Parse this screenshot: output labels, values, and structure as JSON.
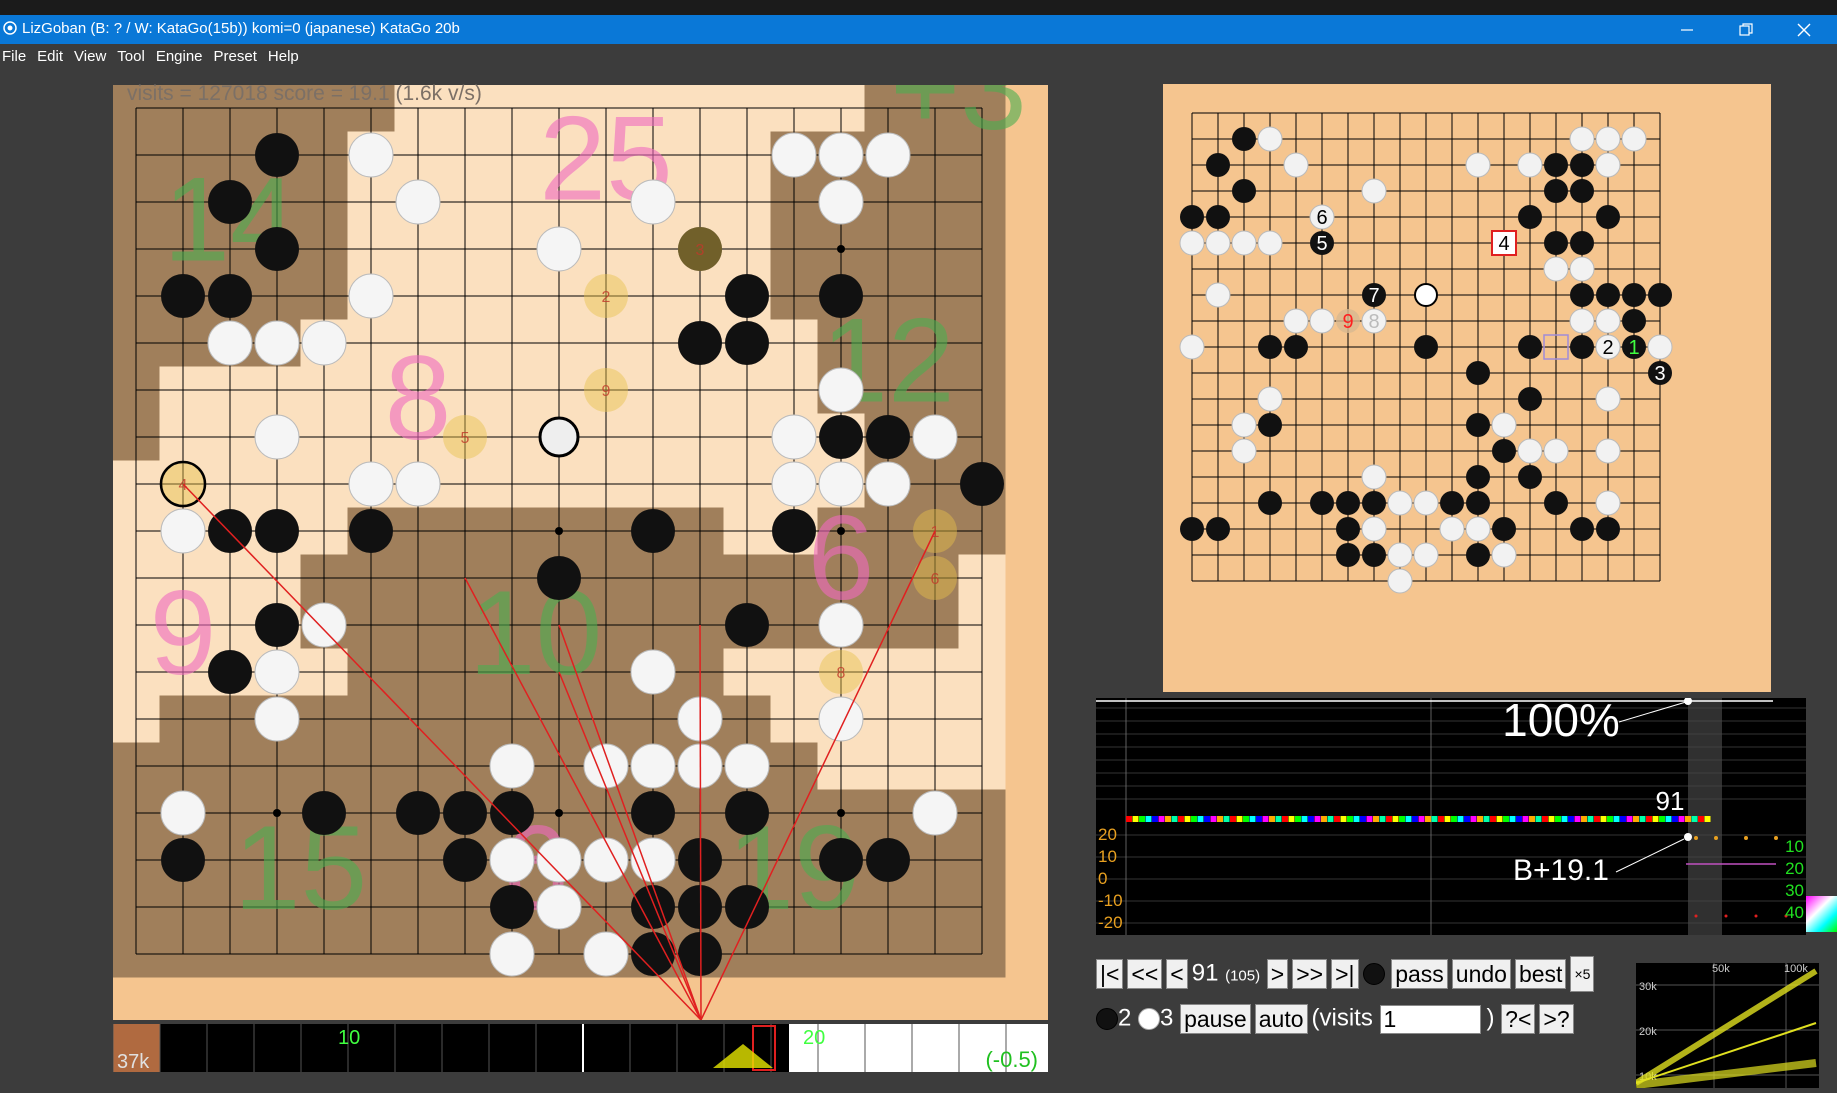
{
  "window": {
    "title": "LizGoban (B: ? / W: KataGo(15b))  komi=0 (japanese) KataGo 20b",
    "controls": [
      "minimize-icon",
      "restore-icon",
      "close-icon"
    ]
  },
  "menu": [
    "File",
    "Edit",
    "View",
    "Tool",
    "Engine",
    "Preset",
    "Help"
  ],
  "status": "visits = 127018  score = 19.1  (1.6k v/s)",
  "board": {
    "size": 19,
    "colors": {
      "wood": "#f5c58f",
      "dark": "#5a4632",
      "line": "#000000"
    },
    "area_rows": [
      "bbbbbbwwwwwwwwwwbbb",
      "bbbbbwwwwwwwwwbbbbb",
      "bbbbbwwwwwwwwwbbbbb",
      "bbbbbwwwwwwwwwbbbbb",
      "bbbbbwwwwwwwwwbbbbb",
      "bbbbwwwwwwwwwwwbbbb",
      "bwwwwwwwwwwwwwwbbbb",
      "bwwwwwwwwwwwwwwwbbb",
      "wwwwwwwwwwwwwwwwbbb",
      "wwwwwbbbbbbbbwwbbbb",
      "wwwwbbbbbbbbbbbbbbw",
      "wwwwbbbbbbbbbbbbbbw",
      "wwwwwbbbbbbbbwwwwww",
      "wbbbbbbbbbbbbbwwwww",
      "bbbbbbbbbbbbbbbwwww",
      "bbbbbbbbbbbbbbbbbbb",
      "bbbbbbbbbbbbbbbbbbb",
      "bbbbbbbbbbbbbbbbbbb",
      "bbbbbbbbbbbbbbbbbbb"
    ],
    "stones_black": [
      [
        3,
        1
      ],
      [
        2,
        2
      ],
      [
        3,
        3
      ],
      [
        1,
        4
      ],
      [
        2,
        4
      ],
      [
        2,
        5
      ],
      [
        13,
        4
      ],
      [
        12,
        3
      ],
      [
        12,
        5
      ],
      [
        13,
        5
      ],
      [
        15,
        4
      ],
      [
        14,
        7
      ],
      [
        15,
        7
      ],
      [
        16,
        7
      ],
      [
        18,
        8
      ],
      [
        2,
        9
      ],
      [
        3,
        9
      ],
      [
        5,
        9
      ],
      [
        11,
        9
      ],
      [
        14,
        9
      ],
      [
        9,
        10
      ],
      [
        3,
        11
      ],
      [
        13,
        11
      ],
      [
        2,
        12
      ],
      [
        3,
        12
      ],
      [
        11,
        12
      ],
      [
        12,
        13
      ],
      [
        11,
        14
      ],
      [
        13,
        14
      ],
      [
        11,
        15
      ],
      [
        1,
        16
      ],
      [
        4,
        15
      ],
      [
        6,
        15
      ],
      [
        7,
        15
      ],
      [
        8,
        15
      ],
      [
        11,
        16
      ],
      [
        12,
        16
      ],
      [
        15,
        16
      ],
      [
        16,
        16
      ],
      [
        7,
        16
      ],
      [
        8,
        17
      ],
      [
        11,
        17
      ],
      [
        12,
        17
      ],
      [
        13,
        17
      ],
      [
        11,
        18
      ],
      [
        12,
        18
      ],
      [
        13,
        15
      ]
    ],
    "stones_white": [
      [
        5,
        1
      ],
      [
        6,
        2
      ],
      [
        5,
        4
      ],
      [
        4,
        5
      ],
      [
        3,
        5
      ],
      [
        2,
        5
      ],
      [
        9,
        3
      ],
      [
        14,
        1
      ],
      [
        15,
        1
      ],
      [
        16,
        1
      ],
      [
        15,
        2
      ],
      [
        11,
        2
      ],
      [
        14,
        7
      ],
      [
        15,
        6
      ],
      [
        17,
        7
      ],
      [
        16,
        8
      ],
      [
        15,
        8
      ],
      [
        14,
        8
      ],
      [
        5,
        8
      ],
      [
        6,
        8
      ],
      [
        3,
        7
      ],
      [
        1,
        9
      ],
      [
        4,
        11
      ],
      [
        3,
        12
      ],
      [
        3,
        13
      ],
      [
        1,
        15
      ],
      [
        8,
        14
      ],
      [
        10,
        14
      ],
      [
        11,
        14
      ],
      [
        12,
        14
      ],
      [
        11,
        12
      ],
      [
        12,
        13
      ],
      [
        13,
        14
      ],
      [
        15,
        11
      ],
      [
        15,
        13
      ],
      [
        17,
        15
      ],
      [
        8,
        16
      ],
      [
        9,
        16
      ],
      [
        9,
        17
      ],
      [
        10,
        16
      ],
      [
        11,
        16
      ],
      [
        8,
        18
      ],
      [
        10,
        18
      ]
    ],
    "numbers": [
      {
        "text": "14",
        "col": 2,
        "row": 2.5,
        "color": "#4caf50"
      },
      {
        "text": "25",
        "col": 10,
        "row": 1.2,
        "color": "#f06bc0"
      },
      {
        "text": "+3",
        "col": 17.5,
        "row": -0.3,
        "color": "#4caf50"
      },
      {
        "text": "12",
        "col": 16,
        "row": 5.5,
        "color": "#4caf50"
      },
      {
        "text": "8",
        "col": 6,
        "row": 6.3,
        "color": "#f06bc0"
      },
      {
        "text": "9",
        "col": 1,
        "row": 11.3,
        "color": "#f06bc0"
      },
      {
        "text": "10",
        "col": 8.5,
        "row": 11.3,
        "color": "#4caf50"
      },
      {
        "text": "6",
        "col": 15,
        "row": 9.7,
        "color": "#f06bc0"
      },
      {
        "text": "15",
        "col": 3.5,
        "row": 16.3,
        "color": "#4caf50"
      },
      {
        "text": "6",
        "col": 8.5,
        "row": 16.3,
        "color": "#f06bc0"
      },
      {
        "text": "19",
        "col": 14,
        "row": 16.3,
        "color": "#4caf50"
      }
    ],
    "candidates": [
      {
        "text": "1",
        "col": 17,
        "row": 9
      },
      {
        "text": "2",
        "col": 10,
        "row": 4
      },
      {
        "text": "3",
        "col": 12,
        "row": 3
      },
      {
        "text": "4",
        "col": 1,
        "row": 8
      },
      {
        "text": "5",
        "col": 7,
        "row": 7
      },
      {
        "text": "6",
        "col": 17,
        "row": 10
      },
      {
        "text": "8",
        "col": 15,
        "row": 12
      },
      {
        "text": "9",
        "col": 10,
        "row": 6
      }
    ]
  },
  "subboard": {
    "black": [
      [
        2,
        1
      ],
      [
        1,
        2
      ],
      [
        2,
        3
      ],
      [
        0,
        4
      ],
      [
        1,
        4
      ],
      [
        1,
        5
      ],
      [
        5,
        4
      ],
      [
        10,
        15
      ],
      [
        15,
        2
      ],
      [
        14,
        2
      ],
      [
        15,
        3
      ],
      [
        14,
        3
      ],
      [
        16,
        4
      ],
      [
        13,
        4
      ],
      [
        14,
        5
      ],
      [
        15,
        5
      ],
      [
        16,
        7
      ],
      [
        15,
        7
      ],
      [
        17,
        7
      ],
      [
        17,
        8
      ],
      [
        3,
        9
      ],
      [
        4,
        9
      ],
      [
        9,
        9
      ],
      [
        13,
        9
      ],
      [
        15,
        9
      ],
      [
        11,
        10
      ],
      [
        13,
        11
      ],
      [
        3,
        11
      ],
      [
        2,
        12
      ],
      [
        3,
        12
      ],
      [
        11,
        12
      ],
      [
        12,
        13
      ],
      [
        11,
        14
      ],
      [
        13,
        14
      ],
      [
        11,
        15
      ],
      [
        0,
        16
      ],
      [
        1,
        16
      ],
      [
        3,
        15
      ],
      [
        5,
        15
      ],
      [
        6,
        15
      ],
      [
        7,
        15
      ],
      [
        6,
        16
      ],
      [
        7,
        17
      ],
      [
        6,
        17
      ],
      [
        11,
        16
      ],
      [
        12,
        16
      ],
      [
        11,
        17
      ],
      [
        12,
        17
      ],
      [
        14,
        15
      ],
      [
        15,
        16
      ],
      [
        16,
        16
      ],
      [
        18,
        7
      ]
    ],
    "white": [
      [
        3,
        1
      ],
      [
        4,
        2
      ],
      [
        1,
        5
      ],
      [
        0,
        5
      ],
      [
        2,
        5
      ],
      [
        3,
        5
      ],
      [
        11,
        2
      ],
      [
        15,
        1
      ],
      [
        16,
        1
      ],
      [
        17,
        1
      ],
      [
        16,
        2
      ],
      [
        13,
        2
      ],
      [
        7,
        3
      ],
      [
        14,
        6
      ],
      [
        15,
        6
      ],
      [
        16,
        8
      ],
      [
        15,
        8
      ],
      [
        16,
        9
      ],
      [
        18,
        9
      ],
      [
        1,
        7
      ],
      [
        4,
        8
      ],
      [
        5,
        8
      ],
      [
        0,
        9
      ],
      [
        3,
        11
      ],
      [
        2,
        12
      ],
      [
        2,
        13
      ],
      [
        12,
        12
      ],
      [
        13,
        13
      ],
      [
        14,
        13
      ],
      [
        16,
        11
      ],
      [
        16,
        13
      ],
      [
        16,
        15
      ],
      [
        7,
        14
      ],
      [
        8,
        15
      ],
      [
        9,
        15
      ],
      [
        7,
        16
      ],
      [
        10,
        16
      ],
      [
        8,
        17
      ],
      [
        9,
        17
      ],
      [
        11,
        16
      ],
      [
        12,
        17
      ],
      [
        8,
        18
      ]
    ],
    "seq": [
      {
        "n": "1",
        "col": 17,
        "row": 9,
        "stone": "black",
        "color": "#40ff40"
      },
      {
        "n": "2",
        "col": 16,
        "row": 9,
        "stone": "white",
        "color": "#000"
      },
      {
        "n": "3",
        "col": 18,
        "row": 10,
        "stone": "black",
        "color": "#fff"
      },
      {
        "n": "4",
        "col": 12,
        "row": 5,
        "stone": "box",
        "color": "#000"
      },
      {
        "n": "5",
        "col": 5,
        "row": 5,
        "stone": "black",
        "color": "#fff"
      },
      {
        "n": "6",
        "col": 5,
        "row": 4,
        "stone": "white",
        "color": "#000"
      },
      {
        "n": "7",
        "col": 7,
        "row": 7,
        "stone": "black",
        "color": "#fff"
      },
      {
        "n": "8",
        "col": 7,
        "row": 8,
        "stone": "white",
        "color": "#bbb"
      },
      {
        "n": "9",
        "col": 6,
        "row": 8,
        "stone": "ghost",
        "color": "#ff2020"
      }
    ]
  },
  "timeline": {
    "visits_label": "37k",
    "marks": [
      "10",
      "20"
    ],
    "score_diff": "(-0.5)"
  },
  "graph": {
    "winrate_label": "100%",
    "move_label": "91",
    "score_label": "B+19.1",
    "left_ticks": [
      "20",
      "10",
      "0",
      "-10",
      "-20"
    ],
    "right_ticks": [
      "10",
      "20",
      "30",
      "40"
    ]
  },
  "controls": {
    "nav": [
      "|<",
      "<<",
      "<"
    ],
    "move_no": "91",
    "move_total": "(105)",
    "nav2": [
      ">",
      ">>",
      ">|"
    ],
    "pass": "pass",
    "undo": "undo",
    "best": "best",
    "x5": "×5",
    "black_count": "2",
    "white_count": "3",
    "pause": "pause",
    "auto": "auto",
    "visits_label": "(visits",
    "visits_value": "1",
    "close_paren": ")",
    "prev_q": "?<",
    "next_q": ">?"
  },
  "speed_chart": {
    "x_labels": [
      "50k",
      "100k"
    ],
    "y_labels": [
      "30k",
      "20k",
      "10k"
    ]
  }
}
